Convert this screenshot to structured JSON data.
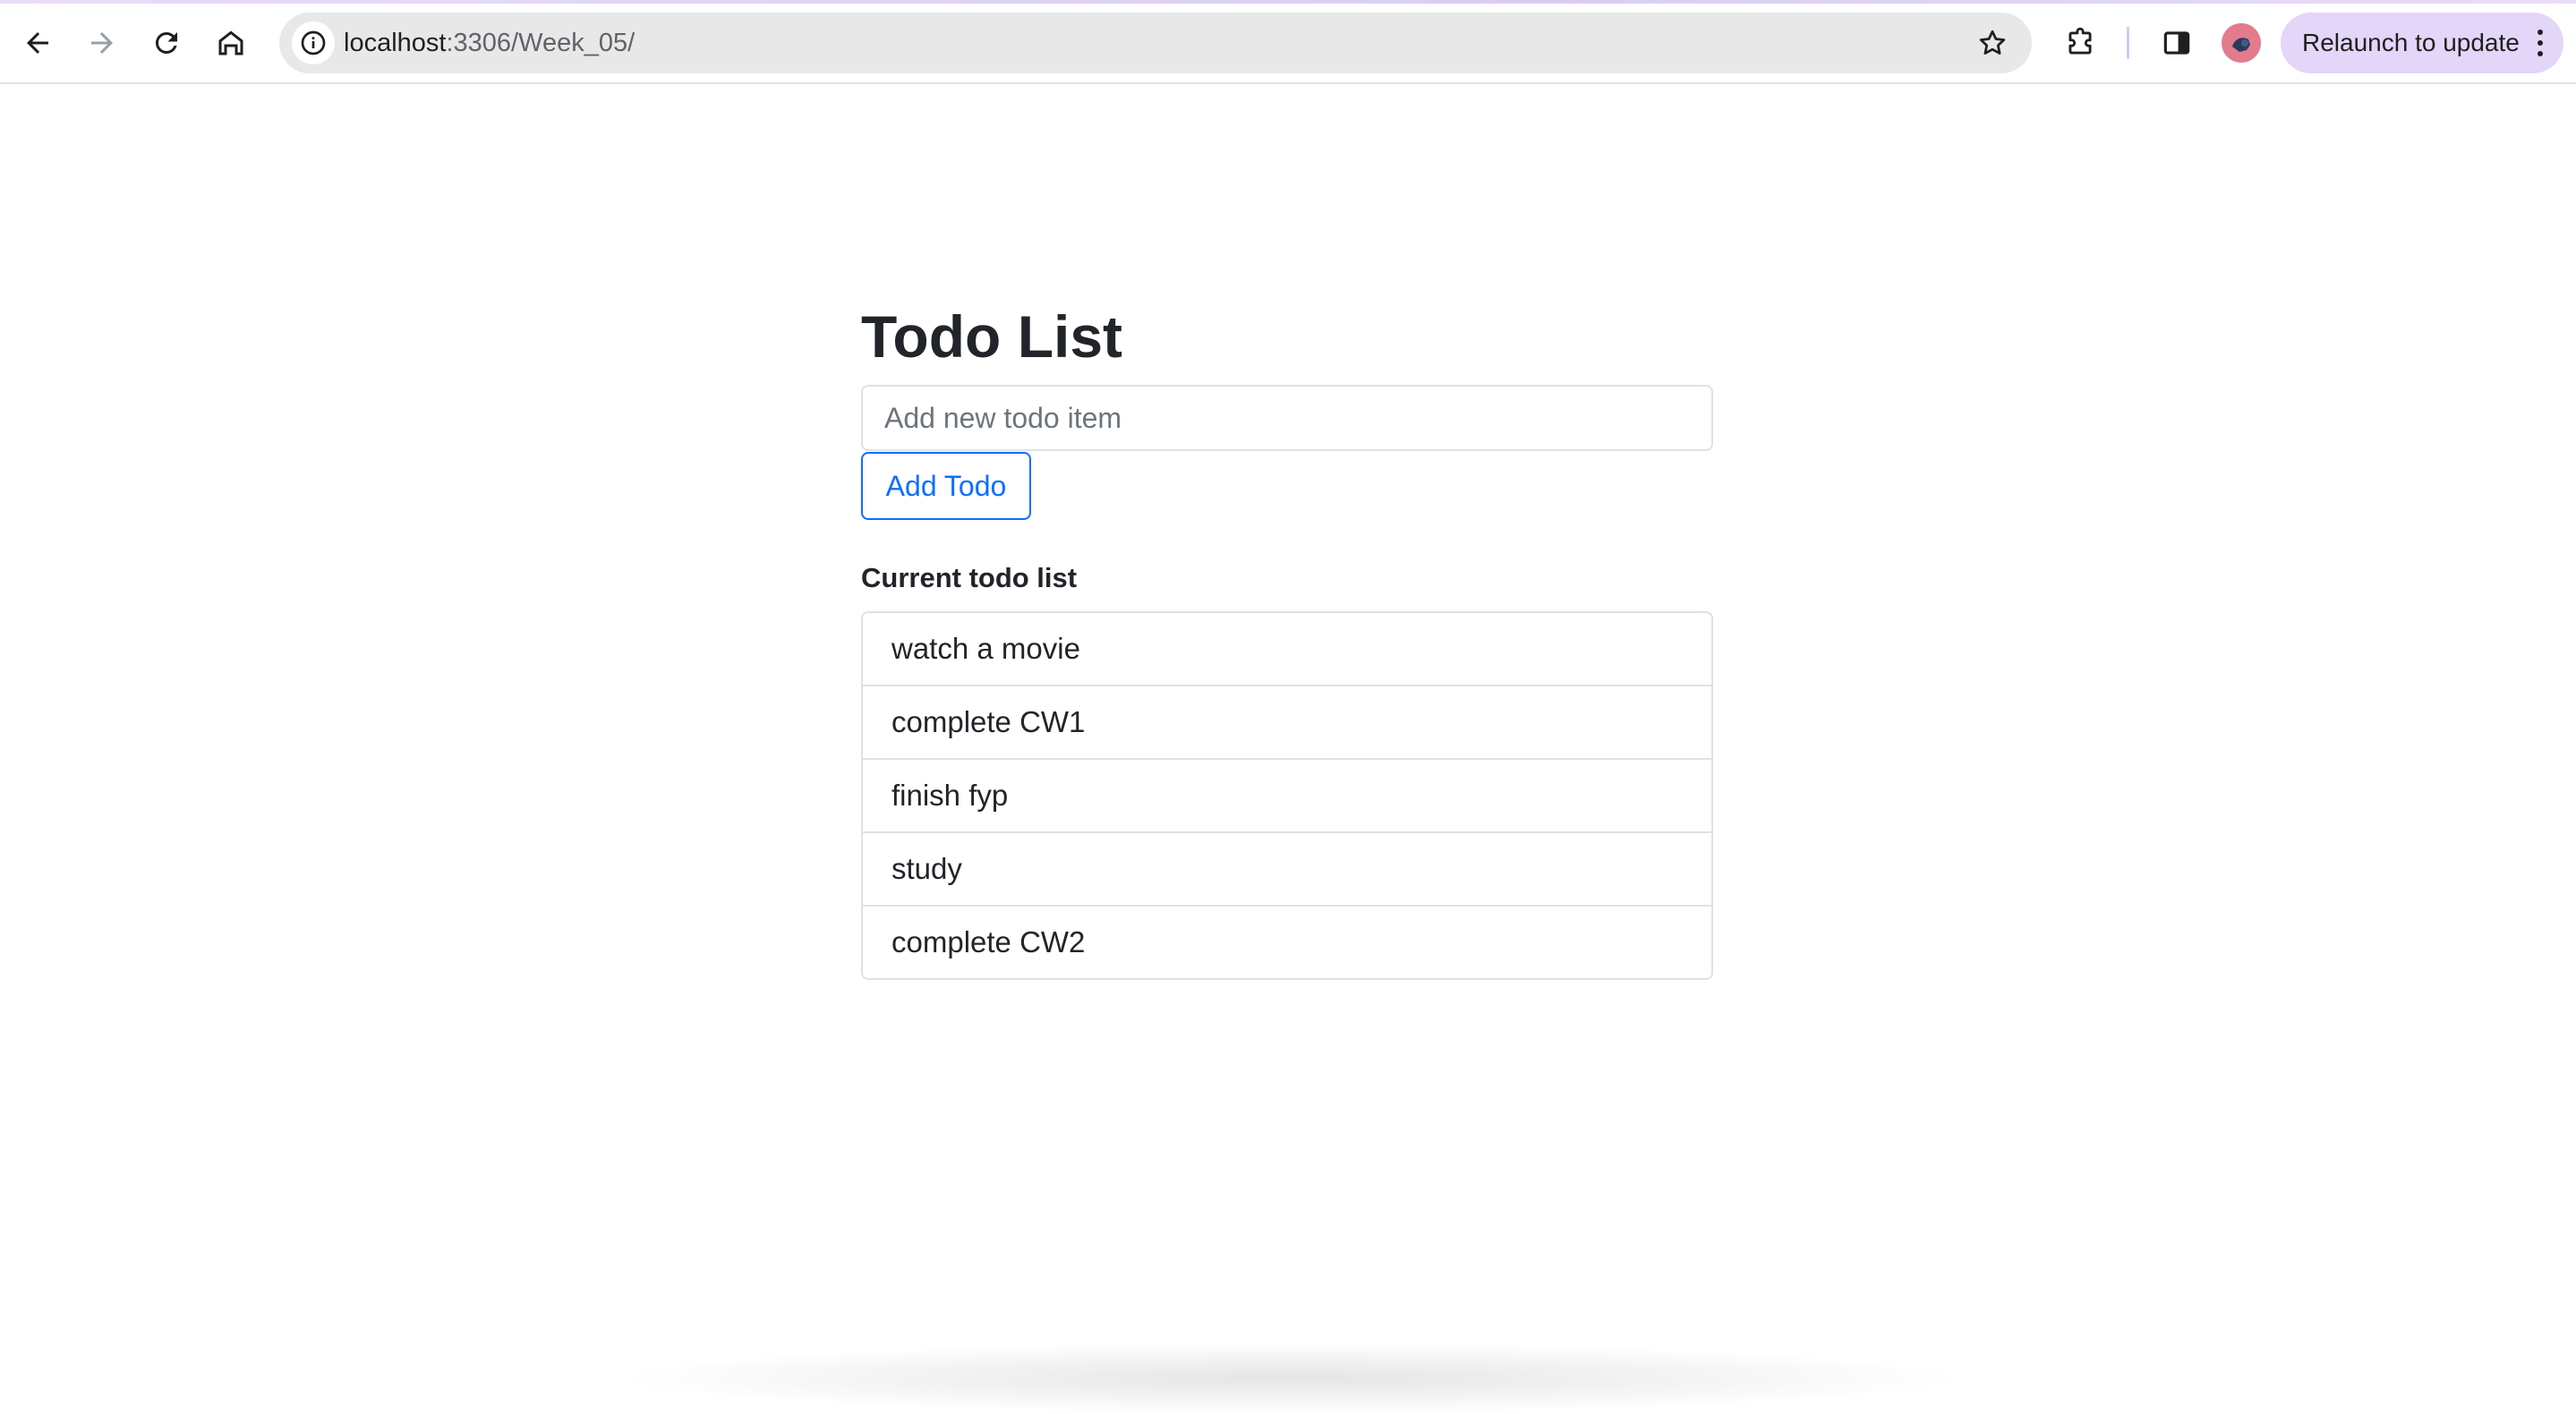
{
  "browser": {
    "url_host": "localhost",
    "url_rest": ":3306/Week_05/",
    "relaunch_label": "Relaunch to update",
    "accent_color": "#e3d6f8"
  },
  "page": {
    "title": "Todo List",
    "input_placeholder": "Add new todo item",
    "input_value": "",
    "add_button_label": "Add Todo",
    "list_heading": "Current todo list",
    "todos": [
      "watch a movie",
      "complete CW1",
      "finish fyp",
      "study",
      "complete CW2"
    ],
    "primary_color": "#0d6efd"
  }
}
